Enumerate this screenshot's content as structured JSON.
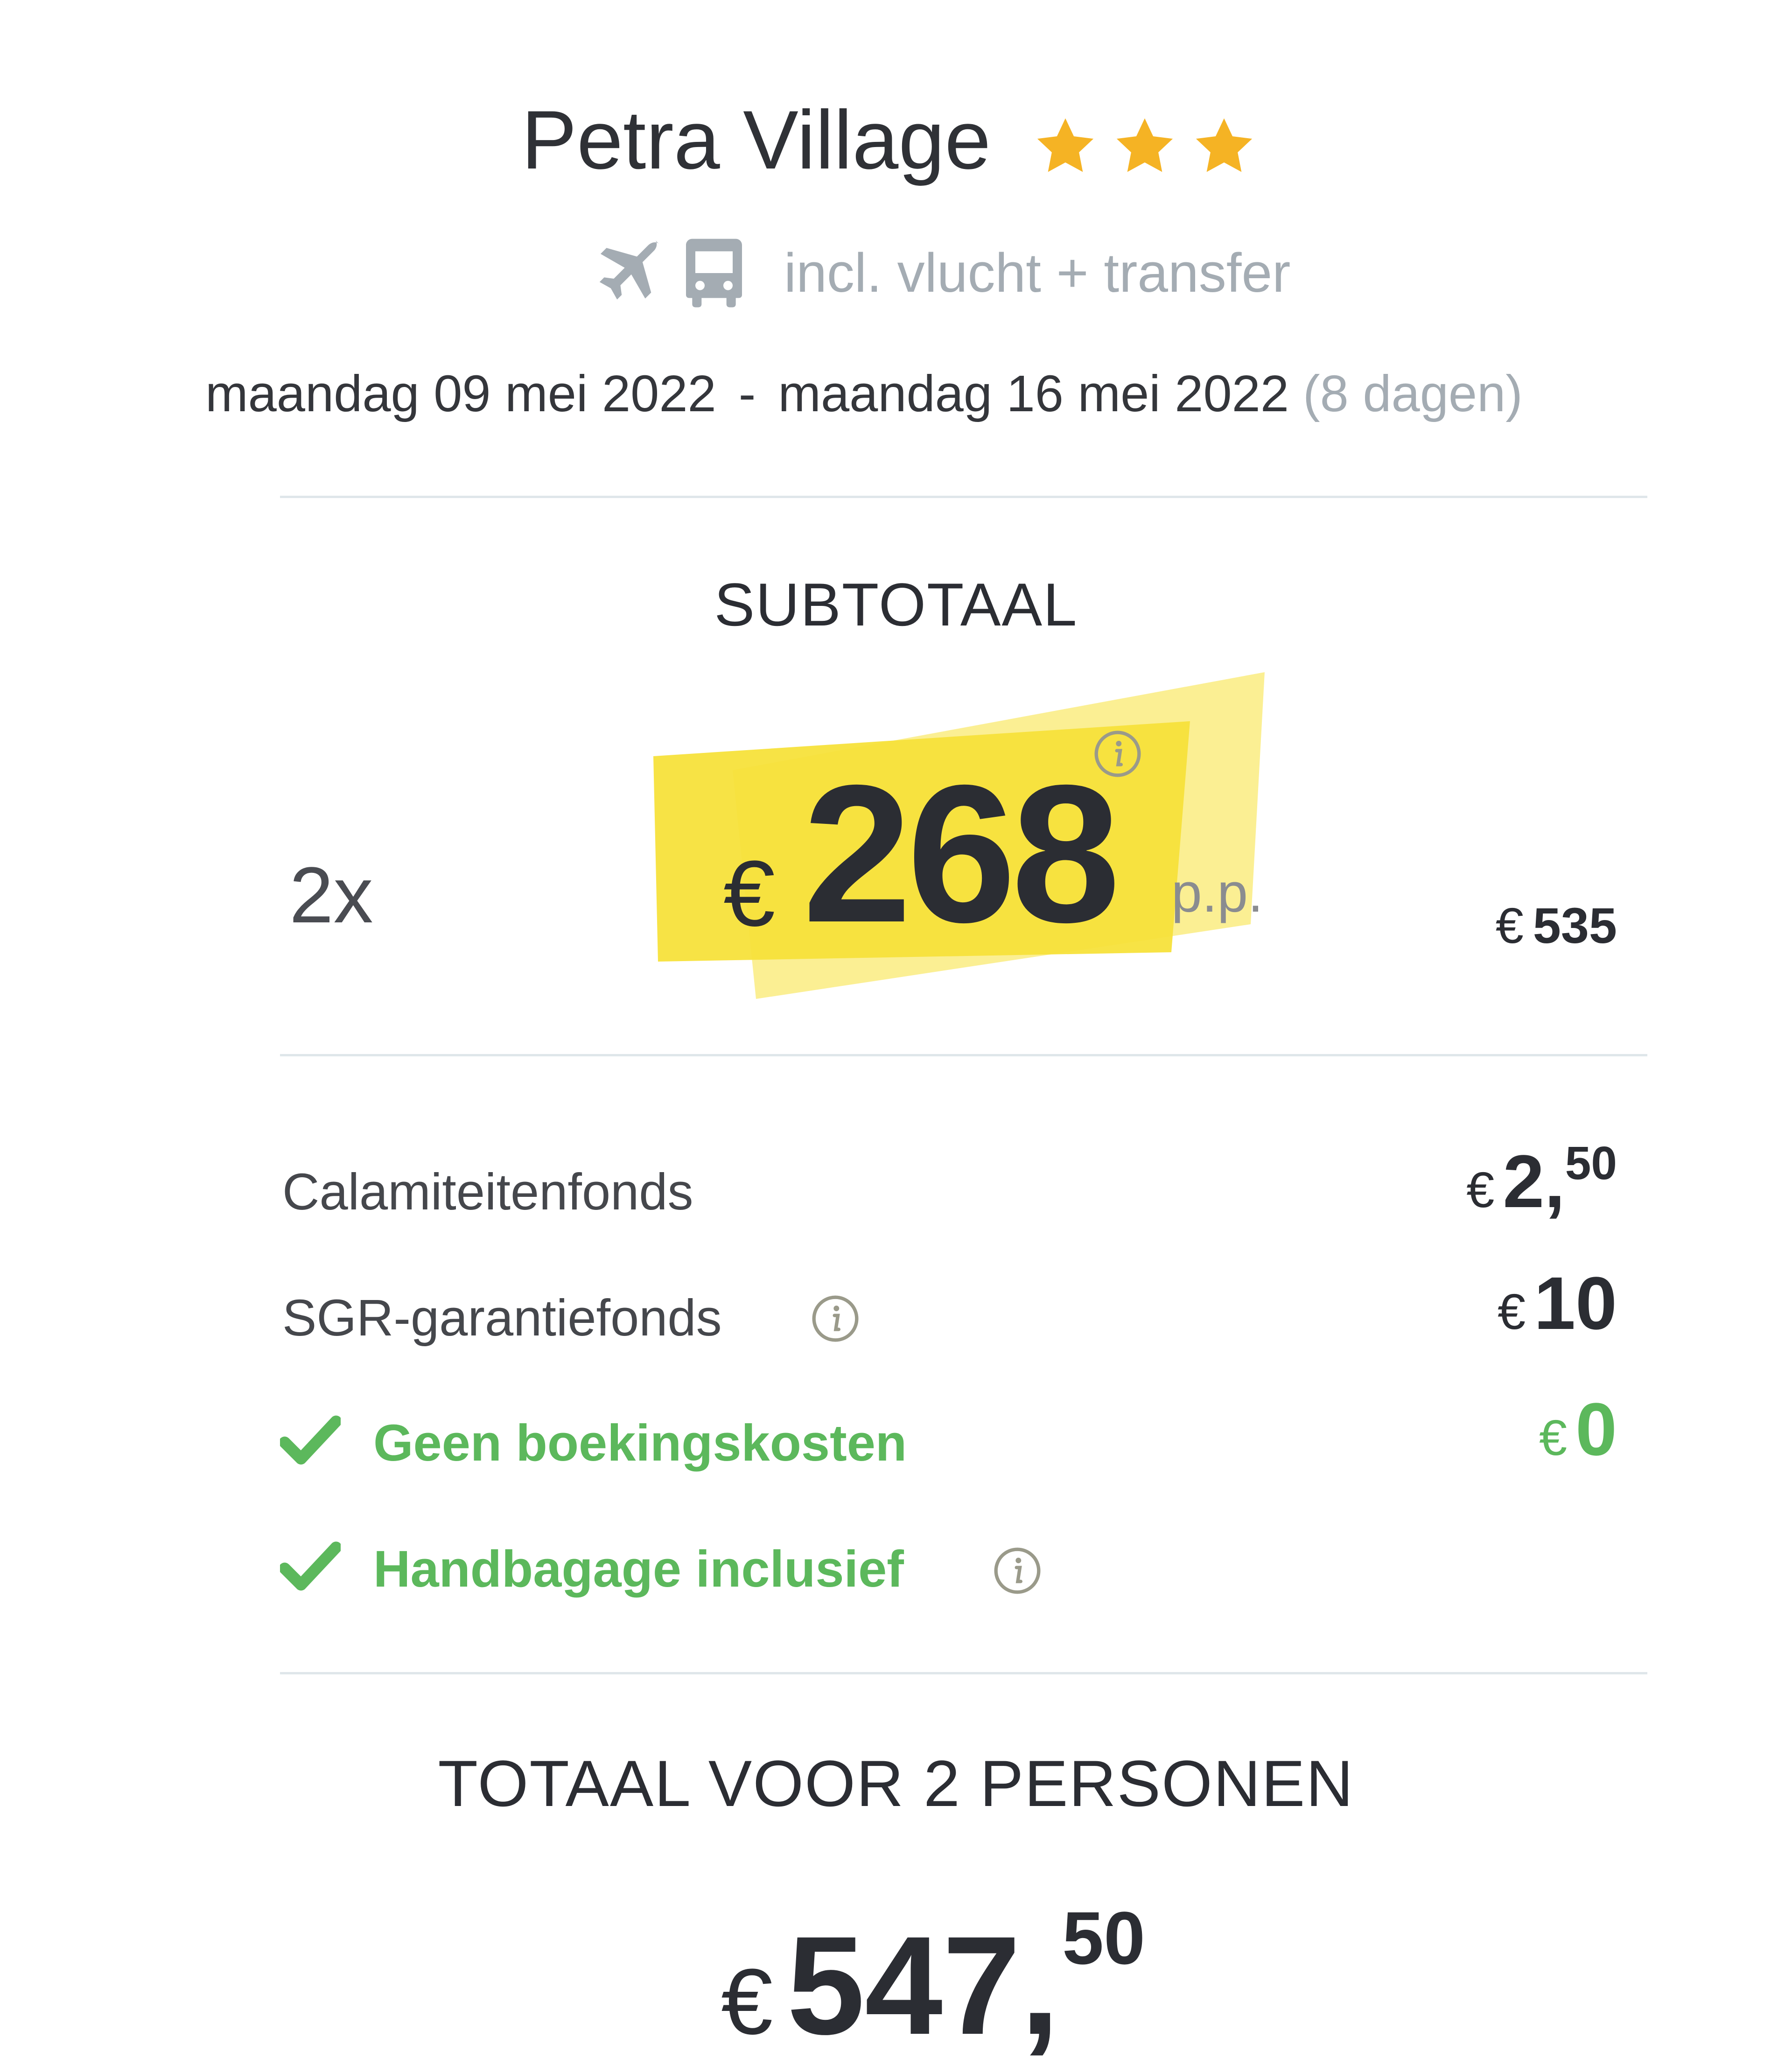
{
  "hotel": {
    "name": "Petra Village",
    "stars": 3
  },
  "travel": {
    "icons": [
      "plane-icon",
      "bus-icon"
    ],
    "includes": "incl. vlucht + transfer"
  },
  "dates": {
    "start": "maandag 09 mei 2022",
    "separator": "-",
    "end": "maandag 16 mei 2022",
    "duration": "(8 dagen)"
  },
  "subtotal": {
    "heading": "SUBTOTAAL",
    "quantity": "2x",
    "currency": "€",
    "price_per_person": "268",
    "pp_label": "p.p.",
    "line_total": "535"
  },
  "costs": [
    {
      "label": "Calamiteitenfonds",
      "currency": "€",
      "whole": "2,",
      "cents": "50",
      "info": false,
      "included": false
    },
    {
      "label": "SGR-garantiefonds",
      "currency": "€",
      "whole": "10",
      "cents": "",
      "info": true,
      "included": false
    },
    {
      "label": "Geen boekingskosten",
      "currency": "€",
      "whole": "0",
      "cents": "",
      "info": false,
      "included": true
    },
    {
      "label": "Handbagage inclusief",
      "currency": "",
      "whole": "",
      "cents": "",
      "info": true,
      "included": true
    }
  ],
  "total": {
    "heading": "TOTAAL VOOR 2 PERSONEN",
    "currency": "€",
    "whole": "547,",
    "cents": "50"
  },
  "colors": {
    "accent_yellow": "#f7e23b",
    "star": "#f5b324",
    "included_green": "#5cb85c",
    "muted_text": "#a4acb3",
    "divider": "#dfe6ea"
  }
}
